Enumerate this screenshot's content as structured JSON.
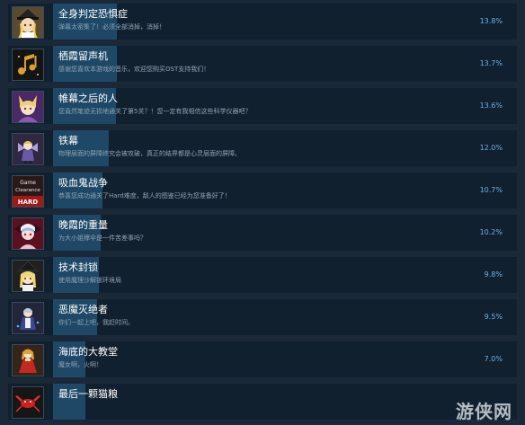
{
  "achievements": [
    {
      "title": "全身判定恐惧症",
      "desc": "弹幕太密集了！必须全部消掉，消掉！",
      "pct": "13.8%",
      "fraction": 0.138,
      "icon": "marisa-portrait-icon"
    },
    {
      "title": "栖霞留声机",
      "desc": "感谢您喜欢本游戏的音乐，欢迎您购买OST支持我们！",
      "pct": "13.7%",
      "fraction": 0.137,
      "icon": "music-note-icon"
    },
    {
      "title": "帷幕之后的人",
      "desc": "您竟然笔迹无损地通关了第5关？！您一定有我相信这些科学仪器吧？",
      "pct": "13.6%",
      "fraction": 0.136,
      "icon": "fox-girl-portrait-icon"
    },
    {
      "title": "铁幕",
      "desc": "物理层面的屏障终究会被攻破，真正的结界都是心灵层面的屏障。",
      "pct": "12.0%",
      "fraction": 0.12,
      "icon": "fairy-sprite-icon"
    },
    {
      "title": "吸血鬼战争",
      "desc": "恭喜您成功通关了Hard难度，敌人的图鉴已经为您准备好了！",
      "pct": "10.7%",
      "fraction": 0.107,
      "icon": "game-clearance-hard-icon",
      "icon_text": {
        "line1": "Game",
        "line2": "Clearance",
        "line3": "HARD"
      }
    },
    {
      "title": "晚霞的重量",
      "desc": "为大小姐撑伞是一件苦差事吗？",
      "pct": "10.2%",
      "fraction": 0.102,
      "icon": "remilia-portrait-icon"
    },
    {
      "title": "技术封锁",
      "desc": "使用魔理沙解锁环境局",
      "pct": "9.8%",
      "fraction": 0.098,
      "icon": "witch-girl-portrait-icon"
    },
    {
      "title": "恶魔灭绝者",
      "desc": "你们一起上吧，我赶时间。",
      "pct": "9.5%",
      "fraction": 0.095,
      "icon": "maid-sprite-icon"
    },
    {
      "title": "海底的大教堂",
      "desc": "魔女啊，火啊！",
      "pct": "7.0%",
      "fraction": 0.07,
      "icon": "red-dress-sprite-icon"
    },
    {
      "title": "最后一颗猫粮",
      "desc": "",
      "pct": "",
      "fraction": 0.069,
      "icon": "red-crab-sprite-icon"
    }
  ],
  "watermark": "游侠网",
  "colors": {
    "background": "#1b2838",
    "row": "#11202e",
    "progress_fill": "#1e4866",
    "percent_text": "#6ab1e8"
  }
}
